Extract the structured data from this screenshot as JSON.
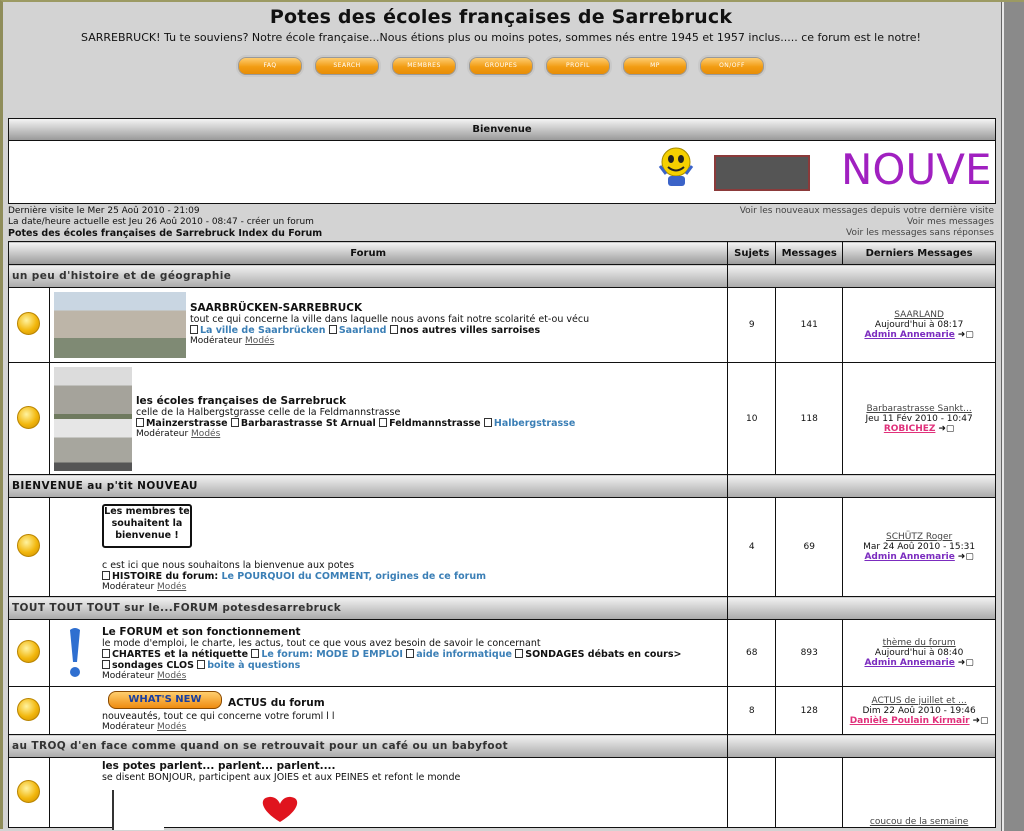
{
  "header": {
    "title": "Potes des écoles françaises de Sarrebruck",
    "description": "SARREBRUCK! Tu te souviens? Notre école française...Nous étions plus ou moins potes, sommes nés entre 1945 et 1957 inclus..... ce forum est le notre!"
  },
  "nav": [
    "FAQ",
    "SEARCH",
    "MEMBRES",
    "GROUPES",
    "PROFIL",
    "MP",
    "ON/OFF"
  ],
  "welcome": {
    "title": "Bienvenue",
    "banner_text": "NOUVE"
  },
  "info": {
    "last_visit": "Dernière visite le Mer 25 Aoû 2010 - 21:09",
    "current_time": "La date/heure actuelle est Jeu 26 Aoû 2010 - 08:47 - créer un forum",
    "breadcrumb": "Potes des écoles françaises de Sarrebruck Index du Forum",
    "link_new": "Voir les nouveaux messages depuis votre dernière visite",
    "link_mine": "Voir mes messages",
    "link_unanswered": "Voir les messages sans réponses"
  },
  "table_headers": {
    "forum": "Forum",
    "topics": "Sujets",
    "posts": "Messages",
    "last": "Derniers Messages"
  },
  "categories": {
    "c1": "un peu d'histoire et de géographie",
    "c2": "BIENVENUE au p'tit NOUVEAU",
    "c3": "TOUT TOUT TOUT sur le...FORUM potesdesarrebruck",
    "c4": "au TROQ d'en face comme quand on se retrouvait pour un café ou un babyfoot"
  },
  "forums": {
    "f1": {
      "name": "SAARBRÜCKEN-SARREBRUCK",
      "desc": "tout ce qui concerne la ville dans laquelle nous avons fait notre scolarité et-ou vécu",
      "sub1": "La ville de Saarbrücken",
      "sub2": "Saarland",
      "sub3": "nos autres villes sarroises",
      "mod_label": "Modérateur",
      "mod": "Modés",
      "topics": "9",
      "posts": "141",
      "last_title": "SAARLAND",
      "last_date": "Aujourd'hui à 08:17",
      "last_user": "Admin Annemarie"
    },
    "f2": {
      "name": "les écoles françaises de Sarrebruck",
      "desc": "celle de la Halbergstgrasse celle de la Feldmannstrasse",
      "sub1": "Mainzerstrasse",
      "sub2": "Barbarastrasse St Arnual",
      "sub3": "Feldmannstrasse",
      "sub4": "Halbergstrasse",
      "mod_label": "Modérateur",
      "mod": "Modés",
      "topics": "10",
      "posts": "118",
      "last_title": "Barbarastrasse Sankt...",
      "last_date": "Jeu 11 Fév 2010 - 10:47",
      "last_user": "ROBICHEZ"
    },
    "f3": {
      "sign": "Les membres te souhaitent la bienvenue !",
      "desc": "c est ici que nous souhaitons la bienvenue aux potes",
      "sub1": "HISTOIRE du forum:",
      "sub2": "Le POURQUOI du COMMENT, origines de ce forum",
      "mod_label": "Modérateur",
      "mod": "Modés",
      "topics": "4",
      "posts": "69",
      "last_title": "SCHÜTZ Roger",
      "last_date": "Mar 24 Aoû 2010 - 15:31",
      "last_user": "Admin Annemarie"
    },
    "f4": {
      "name": "Le FORUM et son fonctionnement",
      "desc": "le mode d'emploi, le charte, les actus, tout ce que vous avez besoin de savoir le concernant",
      "sub1": "CHARTES et la nétiquette",
      "sub2": "Le forum: MODE D EMPLOI",
      "sub3": "aide informatique",
      "sub4": "SONDAGES débats en cours>",
      "sub5": "sondages CLOS",
      "sub6": "boite à questions",
      "mod_label": "Modérateur",
      "mod": "Modés",
      "topics": "68",
      "posts": "893",
      "last_title": "thème du forum",
      "last_date": "Aujourd'hui à 08:40",
      "last_user": "Admin Annemarie"
    },
    "f5": {
      "badge": "WHAT'S NEW",
      "name": "ACTUS du forum",
      "desc": "nouveautés, tout ce qui concerne votre foruml l l",
      "mod_label": "Modérateur",
      "mod": "Modés",
      "topics": "8",
      "posts": "128",
      "last_title": "ACTUS de juillet et ...",
      "last_date": "Dim 22 Aoû 2010 - 19:46",
      "last_user": "Danièle Poulain Kirmair"
    },
    "f6": {
      "name": "les potes parlent... parlent... parlent....",
      "desc": "se disent BONJOUR, participent aux JOIES et aux PEINES et refont le monde",
      "last_title": "coucou de la semaine"
    }
  }
}
